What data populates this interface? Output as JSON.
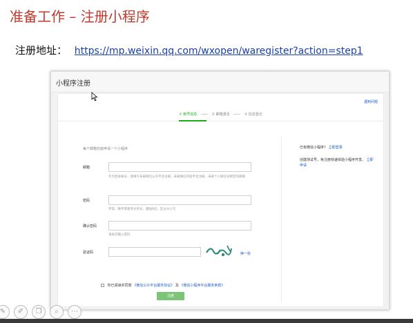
{
  "slide": {
    "title": "准备工作 – 注册小程序",
    "address_label": "注册地址：",
    "address_url": "https://mp.weixin.qq.com/wxopen/waregister?action=step1"
  },
  "screenshot": {
    "header_title": "小程序注册",
    "help_link": "遇到问题",
    "steps": [
      "① 帐号信息",
      "② 邮箱激活",
      "③ 信息登记"
    ],
    "intro": "每个邮箱仅能申请一个小程序",
    "fields": {
      "email_label": "邮箱",
      "email_hint": "作为登录帐号，请填写未被微信公众平台注册，未被微信开放平台注册，未被个人微信号绑定的邮箱",
      "password_label": "密码",
      "password_hint": "字母、数字或者英文符号，最短8位，区分大小写",
      "confirm_label": "确认密码",
      "confirm_hint": "请再次输入密码",
      "captcha_label": "验证码",
      "captcha_refresh": "换一张"
    },
    "agree_text": "你已阅读并同意",
    "agree_link1": "《微信公众平台服务协议》",
    "agree_and": "及",
    "agree_link2": "《微信小程序平台服务条款》",
    "register_button": "注册",
    "sidebar": {
      "question": "已有微信小程序？",
      "login_link": "立即登录",
      "trial_text": "创建测试号，免注册快速体验小程序开发。",
      "trial_link": "立即申请"
    }
  },
  "toolbar": {
    "icons": [
      "pen-icon",
      "pencil-icon",
      "copy-icon",
      "zoom-icon",
      "more-icon"
    ]
  },
  "colors": {
    "title_red": "#c0392b",
    "link_blue": "#1a3fa8",
    "wechat_green": "#1aad19"
  }
}
